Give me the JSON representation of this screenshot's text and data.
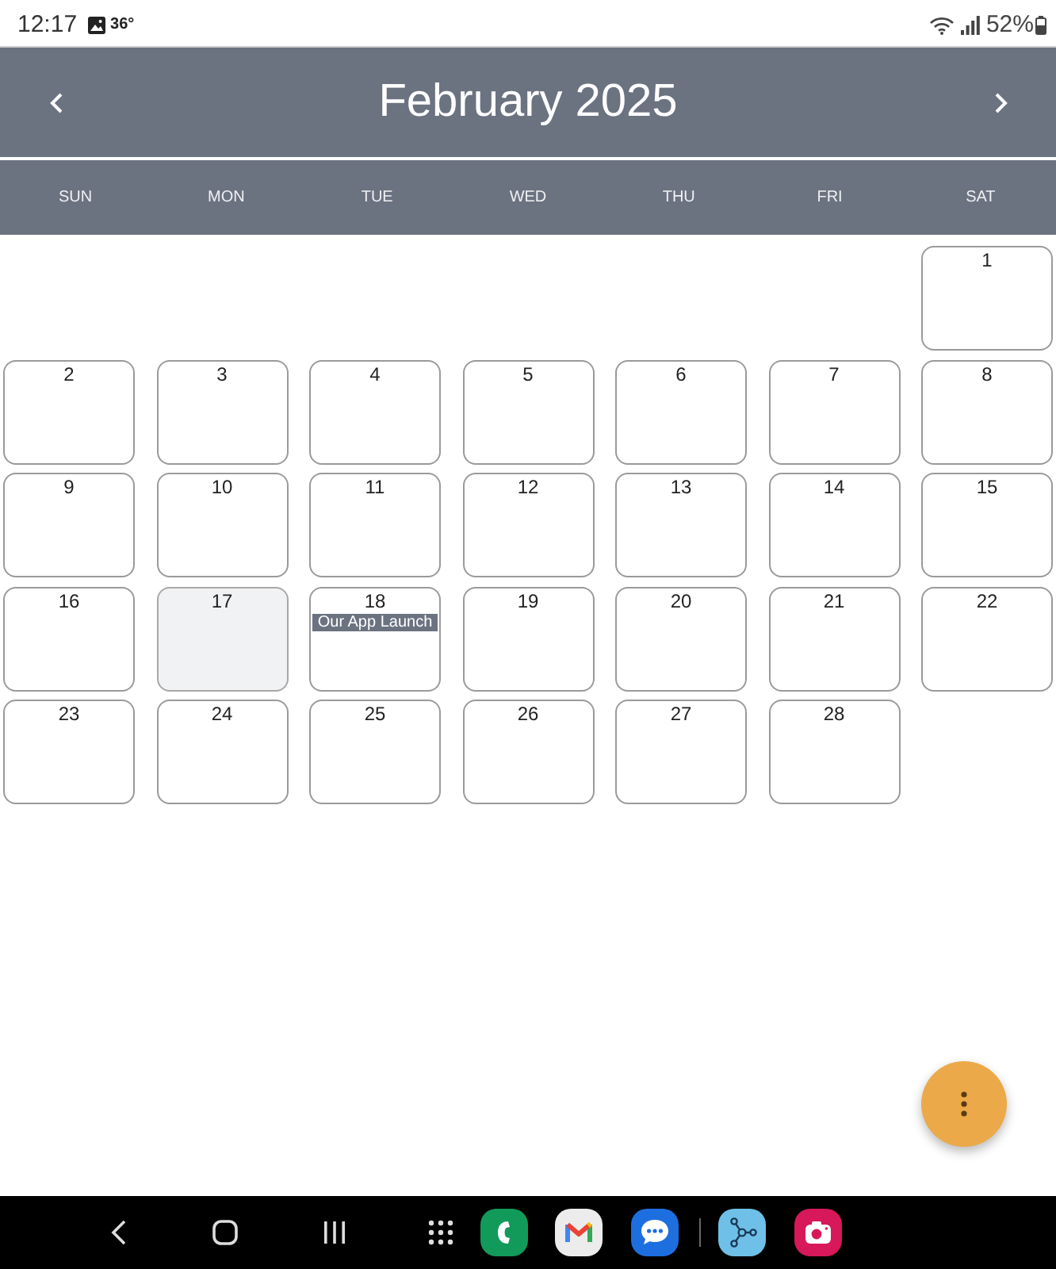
{
  "status_bar": {
    "time": "12:17",
    "temperature": "36°",
    "battery": "52%"
  },
  "header": {
    "title": "February 2025"
  },
  "weekdays": [
    "SUN",
    "MON",
    "TUE",
    "WED",
    "THU",
    "FRI",
    "SAT"
  ],
  "weeks": [
    [
      {
        "kind": "blank"
      },
      {
        "kind": "blank"
      },
      {
        "kind": "blank"
      },
      {
        "kind": "blank"
      },
      {
        "kind": "blank"
      },
      {
        "kind": "blank"
      },
      {
        "kind": "day",
        "label": "1",
        "today": false
      }
    ],
    [
      {
        "kind": "day",
        "label": "2",
        "today": false
      },
      {
        "kind": "day",
        "label": "3",
        "today": false
      },
      {
        "kind": "day",
        "label": "4",
        "today": false
      },
      {
        "kind": "day",
        "label": "5",
        "today": false
      },
      {
        "kind": "day",
        "label": "6",
        "today": false
      },
      {
        "kind": "day",
        "label": "7",
        "today": false
      },
      {
        "kind": "day",
        "label": "8",
        "today": false
      }
    ],
    [
      {
        "kind": "day",
        "label": "9",
        "today": false
      },
      {
        "kind": "day",
        "label": "10",
        "today": false
      },
      {
        "kind": "day",
        "label": "11",
        "today": false
      },
      {
        "kind": "day",
        "label": "12",
        "today": false
      },
      {
        "kind": "day",
        "label": "13",
        "today": false
      },
      {
        "kind": "day",
        "label": "14",
        "today": false
      },
      {
        "kind": "day",
        "label": "15",
        "today": false
      }
    ],
    [
      {
        "kind": "day",
        "label": "16",
        "today": false
      },
      {
        "kind": "day",
        "label": "17",
        "today": true
      },
      {
        "kind": "day",
        "label": "18",
        "today": false,
        "events": [
          {
            "title": "Our App Launch"
          }
        ]
      },
      {
        "kind": "day",
        "label": "19",
        "today": false
      },
      {
        "kind": "day",
        "label": "20",
        "today": false
      },
      {
        "kind": "day",
        "label": "21",
        "today": false
      },
      {
        "kind": "day",
        "label": "22",
        "today": false
      }
    ],
    [
      {
        "kind": "day",
        "label": "23",
        "today": false
      },
      {
        "kind": "day",
        "label": "24",
        "today": false
      },
      {
        "kind": "day",
        "label": "25",
        "today": false
      },
      {
        "kind": "day",
        "label": "26",
        "today": false
      },
      {
        "kind": "day",
        "label": "27",
        "today": false
      },
      {
        "kind": "day",
        "label": "28",
        "today": false
      },
      {
        "kind": "blank"
      }
    ]
  ]
}
